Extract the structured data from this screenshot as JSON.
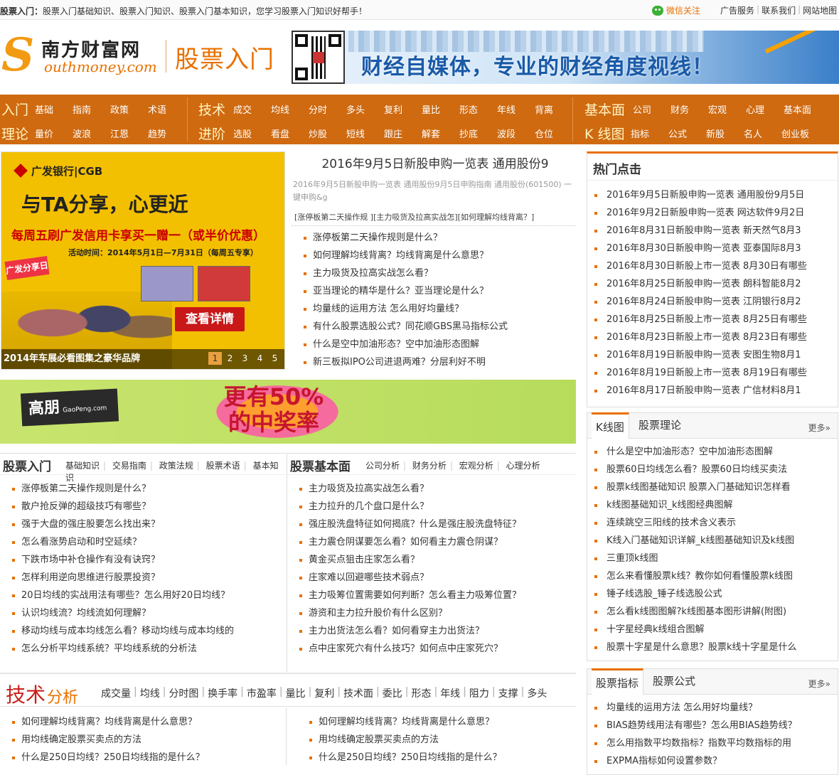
{
  "topbar": {
    "welcome_bold": "股票入门：",
    "welcome": "股票入门基础知识、股票入门知识、股票入门基本知识，您学习股票入门知识好帮手！",
    "wechat": "微信关注",
    "links": [
      "广告服务",
      "联系我们",
      "网站地图"
    ]
  },
  "header": {
    "logo_cn": "南方财富网",
    "logo_s": "S",
    "logo_en": "outhmoney.com",
    "section_title": "股票入门",
    "banner_text": "财经自媒体，专业的财经角度视线！"
  },
  "nav": {
    "row1": {
      "cat1": "入门",
      "items1": [
        "基础",
        "指南",
        "政策",
        "术语"
      ],
      "cat2": "技术",
      "items2": [
        "成交",
        "均线",
        "分时",
        "多头",
        "复利",
        "量比",
        "形态",
        "年线",
        "背离"
      ],
      "cat3": "基本面",
      "items3": [
        "公司",
        "财务",
        "宏观",
        "心理",
        "基本面"
      ]
    },
    "row2": {
      "cat1": "理论",
      "items1": [
        "量价",
        "波浪",
        "江恩",
        "趋势"
      ],
      "cat2": "进阶",
      "items2": [
        "选股",
        "看盘",
        "炒股",
        "短线",
        "跟庄",
        "解套",
        "抄底",
        "波段",
        "仓位"
      ],
      "cat3": "K 线图",
      "items3": [
        "指标",
        "公式",
        "新股",
        "名人",
        "创业板"
      ]
    }
  },
  "slider": {
    "brand": "广发银行|CGB",
    "headline": "与TA分享，心更近",
    "promo": "每周五刷广发信用卡享买一赠一（或半价优惠）",
    "period": "活动时间：2014年5月1日—7月31日（每周五专享）",
    "tag": "广发分享日",
    "button": "查看详情",
    "caption": "2014年车展必看图集之豪华品牌",
    "pages": [
      "1",
      "2",
      "3",
      "4",
      "5"
    ]
  },
  "headline": {
    "title": "2016年9月5日新股申购一览表 通用股份9",
    "summary": "2016年9月5日新股申购一览表 通用股份9月5日申购指南 通用股份(601500) 一键申购&g",
    "tags": "[涨停板第二天操作规 ][主力吸货及拉高实战怎][如何理解均线背离？]",
    "list": [
      "涨停板第二天操作规则是什么？",
      "如何理解均线背离？均线背离是什么意思？",
      "主力吸货及拉高实战怎么看？",
      "亚当理论的精华是什么？亚当理论是什么？",
      "均量线的运用方法 怎么用好均量线？",
      "有什么股票选股公式？同花顺GBS黑马指标公式",
      "什么是空中加油形态？空中加油形态图解",
      "新三板拟IPO公司进退两难？分层利好不明"
    ]
  },
  "gaopeng": {
    "logo": "高朋",
    "logo_small": "GaoPeng.com",
    "text": "更有50%的中奖率"
  },
  "box_intro": {
    "title": "股票入门",
    "subs": [
      "基础知识",
      "交易指南",
      "政策法规",
      "股票术语",
      "基本知识"
    ],
    "list": [
      "涨停板第二天操作规则是什么？",
      "散户抢反弹的超级技巧有哪些？",
      "强于大盘的强庄股要怎么找出来？",
      "怎么看涨势启动和时空延续？",
      "下跌市场中补仓操作有没有诀窍？",
      "怎样利用逆向思维进行股票投资？",
      "20日均线的实战用法有哪些？怎么用好20日均线？",
      "认识均线流？均线流如何理解？",
      "移动均线与成本均线怎么看？移动均线与成本均线的",
      "怎么分析平均线系统？平均线系统的分析法"
    ]
  },
  "box_fund": {
    "title": "股票基本面",
    "subs": [
      "公司分析",
      "财务分析",
      "宏观分析",
      "心理分析"
    ],
    "list": [
      "主力吸货及拉高实战怎么看？",
      "主力拉升的几个盘口是什么？",
      "强庄股洗盘特征如何揭底？什么是强庄股洗盘特征？",
      "主力震仓阴谋要怎么看？如何看主力震仓阴谋？",
      "黄金买点狙击庄家怎么看？",
      "庄家难以回避哪些技术弱点？",
      "主力吸筹位置需要如何判断？怎么看主力吸筹位置？",
      "游资和主力拉升股价有什么区别？",
      "主力出货法怎么看？如何看穿主力出货法？",
      "点中庄家死穴有什么技巧？如何点中庄家死穴？"
    ]
  },
  "tech": {
    "title1": "技术",
    "title2": "分析",
    "keywords": [
      "成交量",
      "均线",
      "分时图",
      "换手率",
      "市盈率",
      "量比",
      "复利",
      "技术面",
      "委比",
      "形态",
      "年线",
      "阻力",
      "支撑",
      "多头"
    ],
    "list_left": [
      "如何理解均线背离？均线背离是什么意思？",
      "用均线确定股票买卖点的方法",
      "什么是250日均线？250日均线指的是什么？"
    ],
    "list_right": [
      "如何理解均线背离？均线背离是什么意思？",
      "用均线确定股票买卖点的方法",
      "什么是250日均线？250日均线指的是什么？"
    ]
  },
  "hot": {
    "title": "热门点击",
    "list": [
      "2016年9月5日新股申购一览表 通用股份9月5日",
      "2016年9月2日新股申购一览表 网达软件9月2日",
      "2016年8月31日新股申购一览表 新天然气8月3",
      "2016年8月30日新股申购一览表 亚泰国际8月3",
      "2016年8月30日新股上市一览表 8月30日有哪些",
      "2016年8月25日新股申购一览表 朗科智能8月2",
      "2016年8月24日新股申购一览表 江阴银行8月2",
      "2016年8月25日新股上市一览表 8月25日有哪些",
      "2016年8月23日新股上市一览表 8月23日有哪些",
      "2016年8月19日新股申购一览表 安图生物8月1",
      "2016年8月19日新股上市一览表 8月19日有哪些",
      "2016年8月17日新股申购一览表 广信材料8月1"
    ]
  },
  "kline": {
    "tab1": "K线图",
    "tab2": "股票理论",
    "more": "更多»",
    "list": [
      "什么是空中加油形态？空中加油形态图解",
      "股票60日均线怎么看？股票60日均线买卖法",
      "股票k线图基础知识 股票入门基础知识怎样看",
      "k线图基础知识_k线图经典图解",
      "连续跳空三阳线的技术含义表示",
      "K线入门基础知识详解_k线图基础知识及k线图",
      "三重顶k线图",
      "怎么来看懂股票k线？教你如何看懂股票k线图",
      "锤子线选股_锤子线选股公式",
      "怎么看k线图图解?k线图基本图形讲解(附图)",
      "十字星经典k线组合图解",
      "股票十字星是什么意思？股票k线十字星是什么"
    ]
  },
  "indicator": {
    "tab1": "股票指标",
    "tab2": "股票公式",
    "more": "更多»",
    "list": [
      "均量线的运用方法 怎么用好均量线？",
      "BIAS趋势线用法有哪些？怎么用BIAS趋势线？",
      "怎么用指数平均数指标？指数平均数指标的用",
      "EXPMA指标如何设置参数？"
    ]
  }
}
